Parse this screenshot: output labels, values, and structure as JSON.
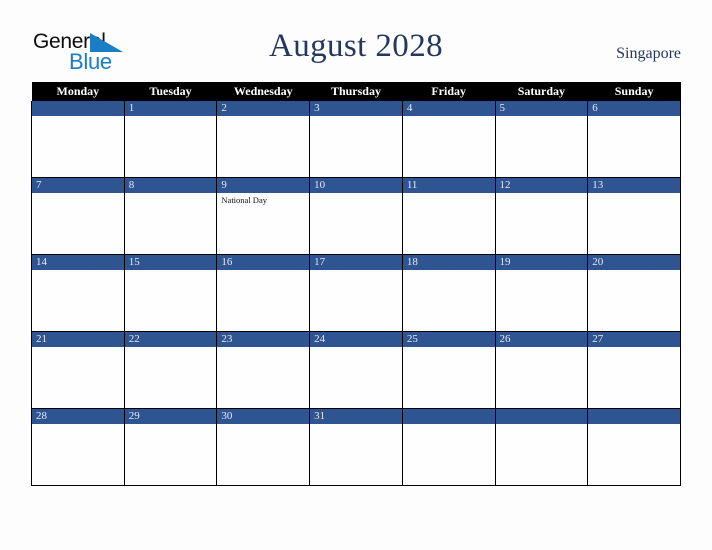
{
  "brand": {
    "word1": "General",
    "word2": "Blue",
    "triangle_icon": "triangle-icon",
    "word1_color": "#0d0d0d",
    "word2_color": "#1b7dc4",
    "triangle_color": "#1b7dc4"
  },
  "header": {
    "title": "August 2028",
    "country": "Singapore",
    "title_color": "#24385f"
  },
  "colors": {
    "day_header_bg": "#000000",
    "day_header_text": "#ffffff",
    "date_bar_bg": "#2e5491",
    "date_bar_text": "#e8eaef",
    "cell_bg": "#fefeff",
    "page_bg": "#fdfdfd",
    "grid_line": "#000000"
  },
  "calendar": {
    "weekday_headers": [
      "Monday",
      "Tuesday",
      "Wednesday",
      "Thursday",
      "Friday",
      "Saturday",
      "Sunday"
    ],
    "weeks": [
      [
        {
          "date": "",
          "events": []
        },
        {
          "date": "1",
          "events": []
        },
        {
          "date": "2",
          "events": []
        },
        {
          "date": "3",
          "events": []
        },
        {
          "date": "4",
          "events": []
        },
        {
          "date": "5",
          "events": []
        },
        {
          "date": "6",
          "events": []
        }
      ],
      [
        {
          "date": "7",
          "events": []
        },
        {
          "date": "8",
          "events": []
        },
        {
          "date": "9",
          "events": [
            "National Day"
          ]
        },
        {
          "date": "10",
          "events": []
        },
        {
          "date": "11",
          "events": []
        },
        {
          "date": "12",
          "events": []
        },
        {
          "date": "13",
          "events": []
        }
      ],
      [
        {
          "date": "14",
          "events": []
        },
        {
          "date": "15",
          "events": []
        },
        {
          "date": "16",
          "events": []
        },
        {
          "date": "17",
          "events": []
        },
        {
          "date": "18",
          "events": []
        },
        {
          "date": "19",
          "events": []
        },
        {
          "date": "20",
          "events": []
        }
      ],
      [
        {
          "date": "21",
          "events": []
        },
        {
          "date": "22",
          "events": []
        },
        {
          "date": "23",
          "events": []
        },
        {
          "date": "24",
          "events": []
        },
        {
          "date": "25",
          "events": []
        },
        {
          "date": "26",
          "events": []
        },
        {
          "date": "27",
          "events": []
        }
      ],
      [
        {
          "date": "28",
          "events": []
        },
        {
          "date": "29",
          "events": []
        },
        {
          "date": "30",
          "events": []
        },
        {
          "date": "31",
          "events": []
        },
        {
          "date": "",
          "events": []
        },
        {
          "date": "",
          "events": []
        },
        {
          "date": "",
          "events": []
        }
      ]
    ]
  }
}
